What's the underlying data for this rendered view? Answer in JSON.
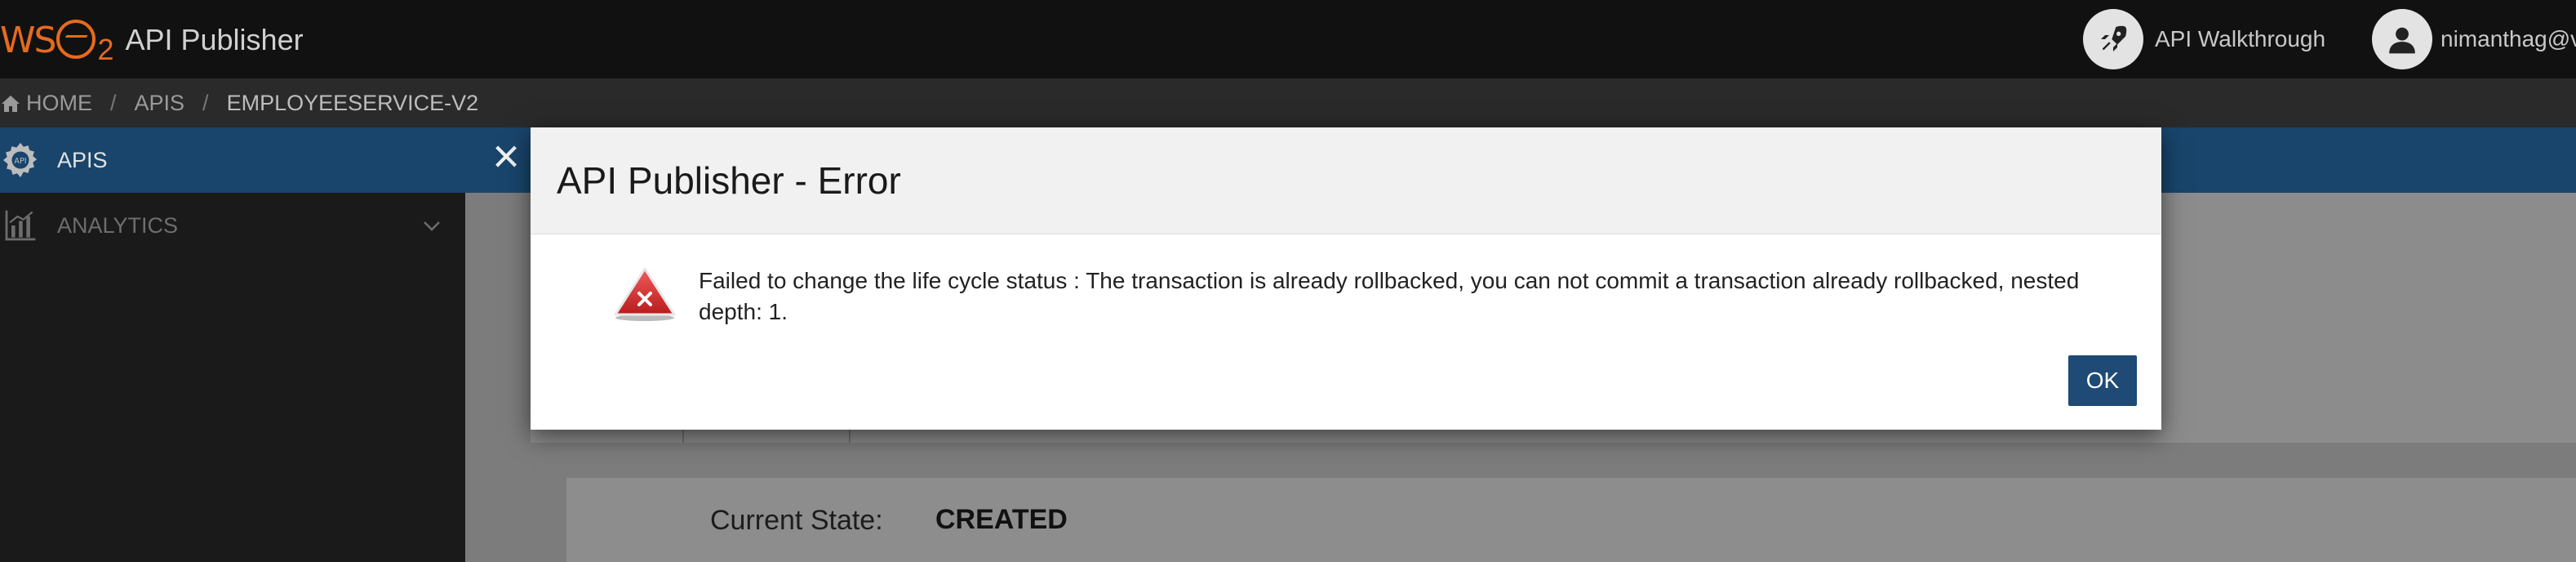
{
  "header": {
    "logo_text": "WSO2",
    "app_title": "API Publisher",
    "walkthrough_label": "API Walkthrough",
    "user_label": "nimanthag@v"
  },
  "breadcrumb": {
    "items": [
      "HOME",
      "APIS",
      "EMPLOYEESERVICE-V2"
    ]
  },
  "sidebar": {
    "items": [
      {
        "label": "APIS",
        "icon": "api-gear-icon",
        "active": true
      },
      {
        "label": "ANALYTICS",
        "icon": "bar-chart-icon",
        "active": false
      }
    ]
  },
  "lifecycle": {
    "current_state_label": "Current State:",
    "current_state_value": "CREATED"
  },
  "modal": {
    "title": "API Publisher - Error",
    "message": "Failed to change the life cycle status : The transaction is already rollbacked, you can not commit a transaction already rollbacked, nested depth: 1.",
    "ok_label": "OK"
  },
  "colors": {
    "brand_orange": "#e66a1e",
    "nav_blue": "#19456c",
    "ok_button": "#1e4a75",
    "error_red": "#d22f2f"
  }
}
